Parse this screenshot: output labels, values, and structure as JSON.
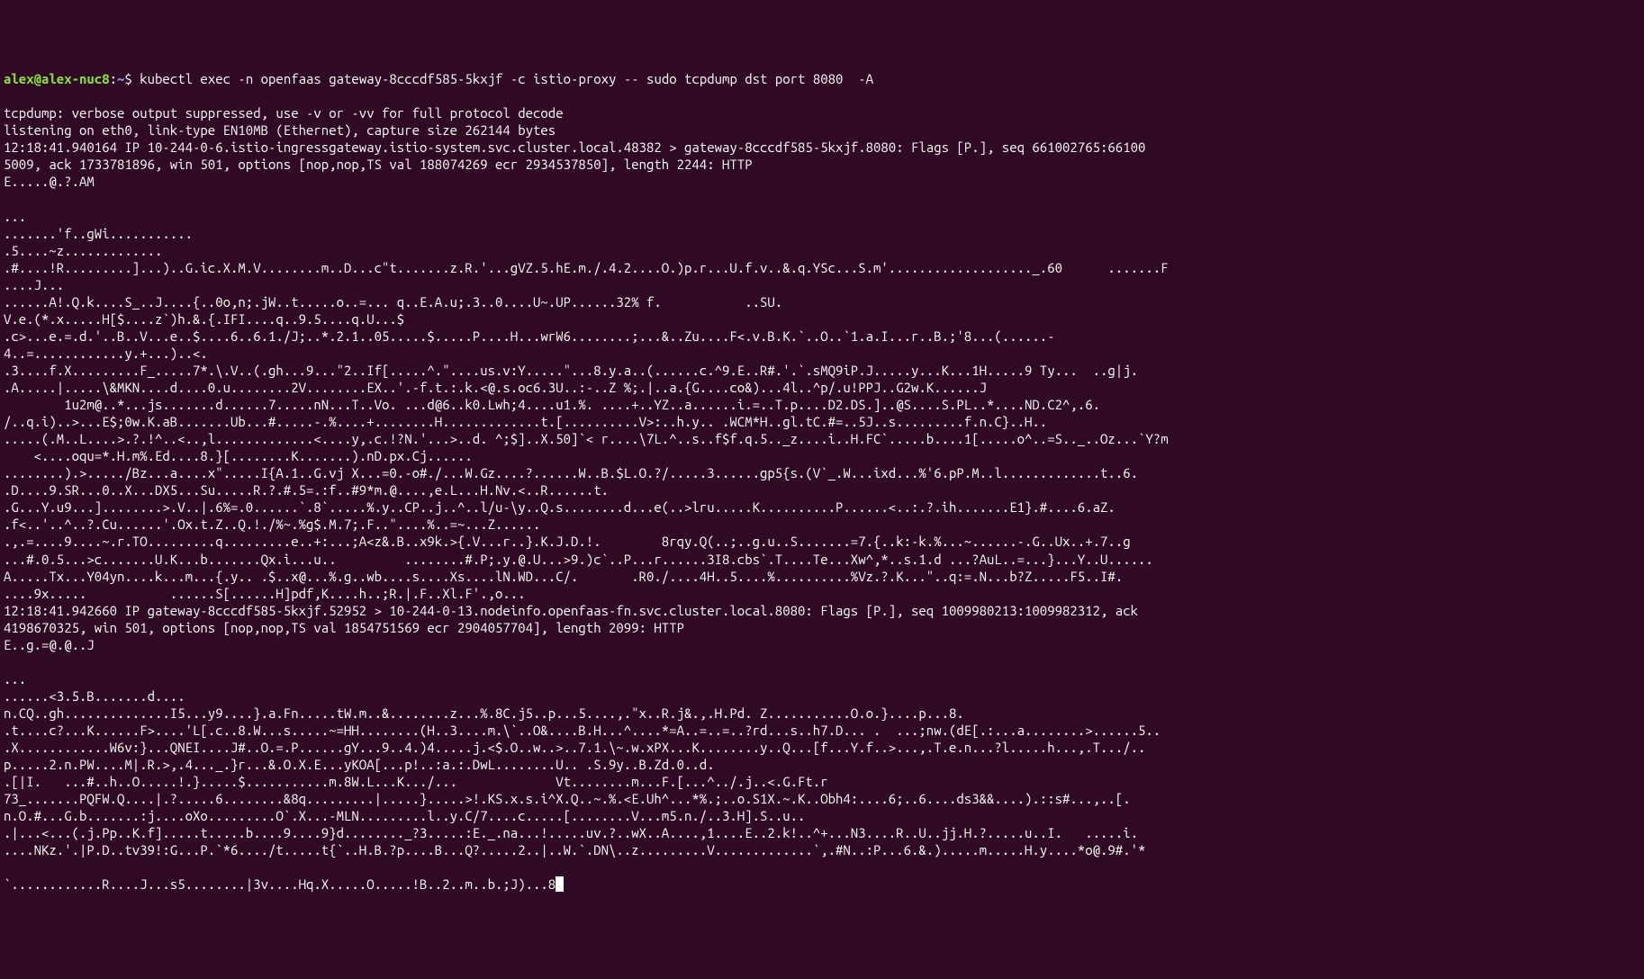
{
  "prompt": {
    "user_host": "alex@alex-nuc8",
    "separator": ":",
    "path": "~",
    "dollar": "$ "
  },
  "command": "kubectl exec -n openfaas gateway-8cccdf585-5kxjf -c istio-proxy -- sudo tcpdump dst port 8080  -A",
  "output_lines": [
    "tcpdump: verbose output suppressed, use -v or -vv for full protocol decode",
    "listening on eth0, link-type EN10MB (Ethernet), capture size 262144 bytes",
    "12:18:41.940164 IP 10-244-0-6.istio-ingressgateway.istio-system.svc.cluster.local.48382 > gateway-8cccdf585-5kxjf.8080: Flags [P.], seq 661002765:66100",
    "5009, ack 1733781896, win 501, options [nop,nop,TS val 188074269 ecr 2934537850], length 2244: HTTP",
    "E.....@.?.AM",
    "",
    "...",
    ".......'f..gWi...........",
    ".5....~z.............",
    ".#....!R.........]...)..G.ic.X.M.V........m..D...c\"t.......z.R.'...gVZ.5.hE.m./.4.2....O.)p.r...U.f.v..&.q.YSc...S.m'..................._.60      .......F",
    "....J...",
    "......A!.Q.k....S_..J....{..0o,n;.jW..t.....o..=... q..E.A.u;.3..0....U~.UP......32% f.           ..SU.",
    "V.e.(*.x.....H[$....z`)h.&.{.IFI....q..9.5....q.U...$",
    ".c>...e.=.d.'..B..V...e..$....6..6.1./J;..*.2.1..05.....$.....P....H...wrW6........;...&..Zu....F<.v.B.K.`..O..`1.a.I...r..B.;'8...(......-",
    "4..=............y.+...)..<.",
    ".3....f.X.........F_.....7*.\\.V..(.gh...9...\"2..If[.....^.\"....us.v:Y.....\"...8.y.a..(......c.^9.E..R#.'.`.sMQ9iP.J.....y...K...1H.....9 Ty...  ..g|j.",
    ".A.....|.....\\&MKN....d....0.u........2V........EX..'.-f.t.:.k.<@.s.oc6.3U..:-..Z %;.|..a.{G....co&)...4l..^p/.u!PPJ..G2w.K......J",
    "        1u2m@..*...js.......d......7.....nN...T..Vo. ...d@6..k0.Lwh;4....u1.%. ....+..YZ..a......i.=..T.p....D2.DS.]..@S....S.PL..*....ND.C2^,.6.",
    "/..q.i)..>...E$;0w.K.aB.......Ub...#.....-.%....+........H.............t.[..........V>:..h.y.. .WCM*H..gl.tC.#=..5J..s.........f.n.C}..H..",
    ".....(.M..L....>.?.!^..<..,l.............<....y,.c.!?N.'...>..d. ^;$]..X.50]`< r....\\7L.^..s..f$f.q.5.._z....i..H.FC`.....b....1[.....o^..=S.._..Oz...`Y?m",
    "    <....oqu=*.H.m%.Ed....8.}[........K.......).nD.px.Cj......",
    "........).>...../Bz...a....x\".....I{A.1..G.vj X...=0.-o#./...W.Gz....?......W..B.$L.O.?/.....3......gp5{s.(V`_.W...ixd...%'6.pP.M..l.............t..6.",
    ".D....9.SR...0..X...DX5...Su.....R.?.#.5=.:f..#9*m.@....,e.L...H.Nv.<..R......t.",
    ".G...Y.u9...]........>.V..|.6%=.0......`.8`.....%.y..CP..j..^..l/u-\\y..Q.s........d...e(..>lru.....K..........P......<..:.?.ih.......E1}.#....6.aZ.",
    ".f<..'..^..?.Cu......'.Ox.t.Z..Q.!./%~.%g$.M.7;.F..\"....%..=~...Z......",
    ".,.=....9....~.r.TO.........q.........e..+:...;A<z&.B..x9k.>{.V...r..}.K.J.D.!.        8rqy.Q(..;..g.u..S.......=7.{..k:-k.%...~......-.G..Ux..+.7..g",
    "...#.0.5...>c.......U.K...b.......Qx.i...u..         ........#.P;.y.@.U...>9.)c`..P...r......3I8.cbs`.T....Te...Xw^,*..s.1.d ...?AuL..=...}...Y..U......",
    "A.....Tx...Y04yn....k...m...{.y.. .$..x@...%.g..wb....s....Xs....lN.WD...C/.       .R0./....4H..5....%..........%Vz.?.K...\"..q:=.N...b?Z.....F5..I#.",
    "....9x.....           ......S[......H]pdf,K....h..;R.|.F..Xl.F'.,o...",
    "12:18:41.942660 IP gateway-8cccdf585-5kxjf.52952 > 10-244-0-13.nodeinfo.openfaas-fn.svc.cluster.local.8080: Flags [P.], seq 1009980213:1009982312, ack ",
    "4198670325, win 501, options [nop,nop,TS val 1854751569 ecr 2904057704], length 2099: HTTP",
    "E..g.=@.@..J",
    "",
    "...",
    "......<3.5.B.......d....",
    "n.CQ..gh..............I5...y9....}.a.Fn.....tW.m..&........z...%.8C.j5..p...5....,.\"x..R.j&.,.H.Pd. Z...........O.o.}....p...8.",
    ".t....c?...K......F>....'L[.c..8.W...s.....~=HH........(H..3....m.\\`..O&....B.H...^....*=A..=..=..?rd...s..h7.D... .  ...;nw.(dE[.:...a........>......5..",
    ".X............W6v:}...QNEI....J#..O.=.P......gY...9..4.)4.....j.<$.O..w..>..7.1.\\~.w.xPX...K........y..Q...[f...Y.f..>...,.T.e.n...?l.....h...,.T.../..",
    "p.....2.n.PW....M|.R.>,.4..._.}r...&.O.X.E...yKOA[...p!..:a.:.DwL........U.. .S.9y..B.Zd.0..d.",
    ".[|I.   ...#..h..O.....!.}.....$...........m.8W.L...K.../...             Vt........m...F.[...^../.j..<.G.Ft.r",
    "73_.......PQFW.Q....|.?.....6........&8q.........|.....}.....>!.KS.x.s.i^X.Q..~.%.<E.Uh^...*%.;..o.S1X.~.K..Obh4:....6;..6....ds3&&....).::s#...,..[.",
    "n.O.#...G.b.......:j....oXo.........O`.X...-MLN.........l..y.C/7....c.....[........V...m5.n./..3.H].S..u..",
    ".|...<...(.j.Pp..K.f].....t.....b....9....9}d........_?3.....:E._.na...!.....uv.?..wX..A....,1....E..2.k!..^+...N3....R..U..jj.H.?.....u..I.   .....i.",
    "....NKz.'.|P.D..tv39!:G...P.`*6..../t.....t{`..H.B.?p....B...Q?.....2..|..W.`.DN\\..z.........V.............`,.#N..:P...6.&.).....m.....H.y....*o@.9#.'*"
  ],
  "last_line": "`............R....J...s5........|3v....Hq.X.....O.....!B..2..m..b.;J)...8"
}
